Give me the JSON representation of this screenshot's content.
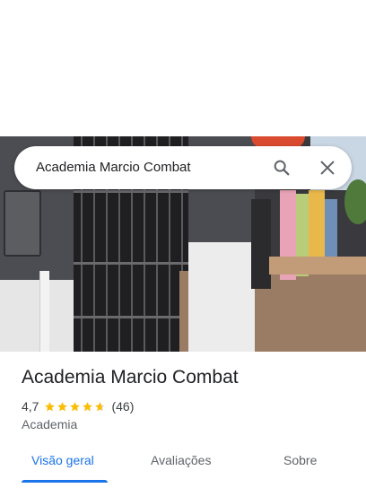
{
  "search": {
    "query": "Academia Marcio Combat"
  },
  "place": {
    "name": "Academia Marcio Combat",
    "rating": "4,7",
    "rating_value": 4.7,
    "review_count": "(46)",
    "category": "Academia"
  },
  "tabs": [
    {
      "label": "Visão geral",
      "active": true
    },
    {
      "label": "Avaliações",
      "active": false
    },
    {
      "label": "Sobre",
      "active": false
    }
  ],
  "colors": {
    "accent": "#1a73e8",
    "star": "#fbbc04"
  },
  "icons": {
    "search": "search-icon",
    "close": "close-icon",
    "star": "star-icon"
  }
}
